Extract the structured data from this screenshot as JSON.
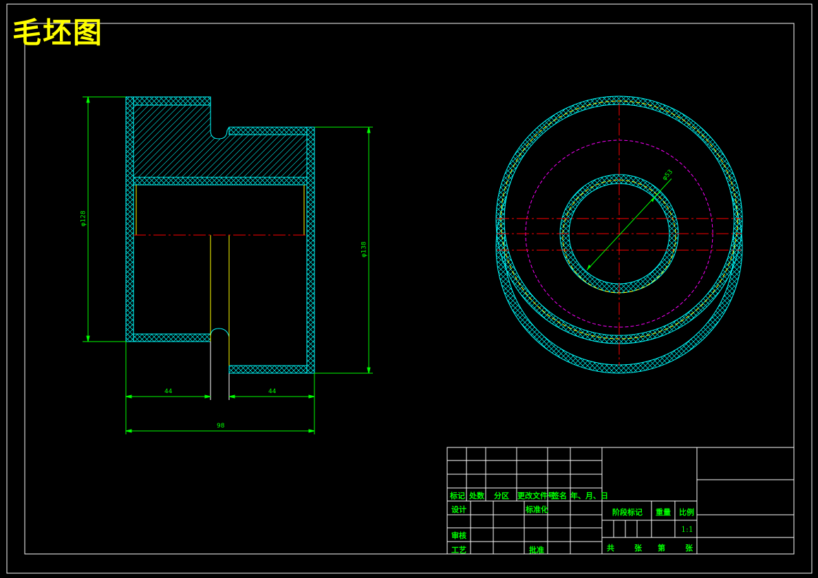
{
  "drawing_title": "毛坯图",
  "dimensions": {
    "left_diameter": "φ128",
    "right_diameter": "φ138",
    "bore_diameter": "φ53",
    "left_length": "44",
    "right_length": "44",
    "total_length": "98"
  },
  "title_block": {
    "headers": [
      "标记",
      "处数",
      "分区",
      "更改文件号",
      "签名",
      "年、月、日"
    ],
    "design": "设计",
    "standardization": "标准化",
    "review": "审核",
    "process": "工艺",
    "approval": "批准",
    "stage_mark": "阶段标记",
    "weight": "重量",
    "scale": "比例",
    "scale_value": "1:1",
    "total": "共",
    "sheets": "张",
    "sheet_no": "第",
    "sheet_suffix": "张"
  },
  "colors": {
    "background": "#000000",
    "frame": "#ffffff",
    "outline": "#00ffff",
    "dimension": "#00ff00",
    "centerline": "#ff0000",
    "hidden": "#ffff00",
    "pitch_circle": "#ff00ff",
    "title": "#ffff00"
  }
}
